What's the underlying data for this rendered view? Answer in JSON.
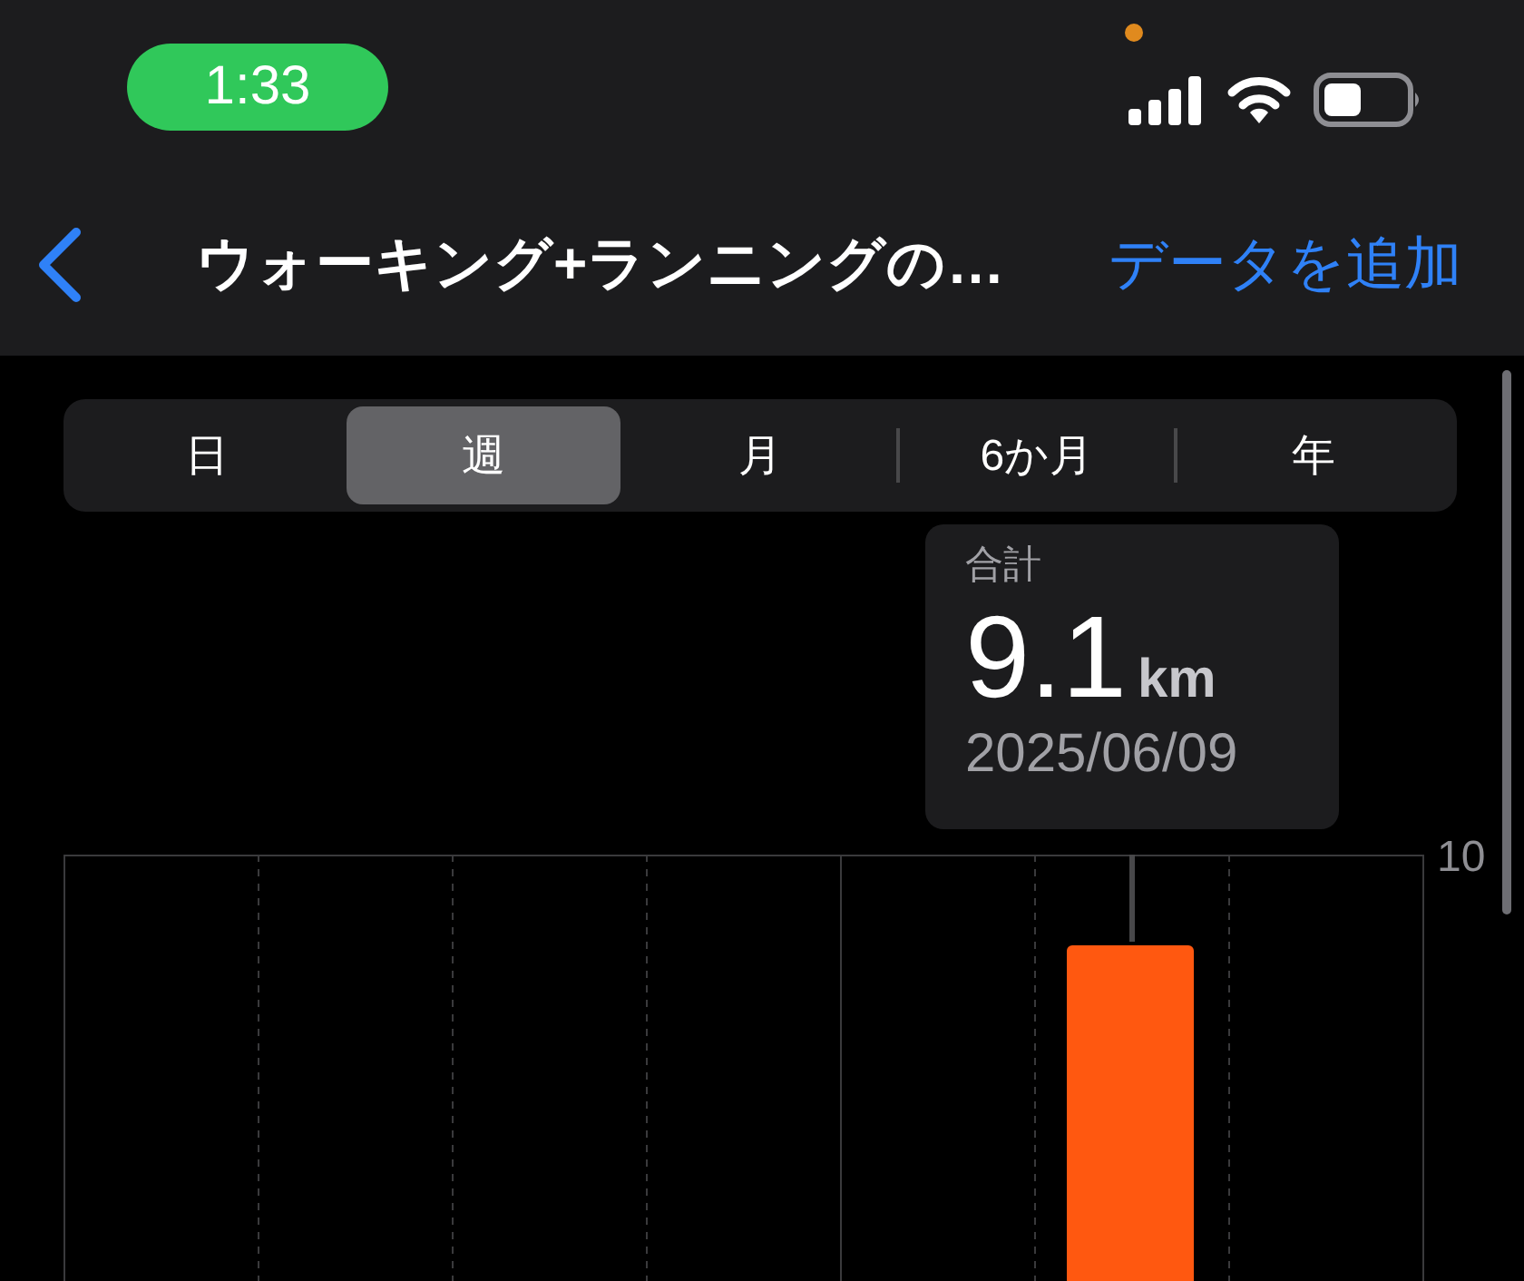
{
  "status_bar": {
    "time": "1:33"
  },
  "nav_bar": {
    "title": "ウォーキング+ランニングの…",
    "action": "データを追加"
  },
  "segments": [
    {
      "label": "日",
      "selected": false
    },
    {
      "label": "週",
      "selected": true
    },
    {
      "label": "月",
      "selected": false
    },
    {
      "label": "6か月",
      "selected": false
    },
    {
      "label": "年",
      "selected": false
    }
  ],
  "tooltip": {
    "label": "合計",
    "value": "9.1",
    "unit": "km",
    "date": "2025/06/09"
  },
  "chart": {
    "y_axis_label": "10"
  }
}
